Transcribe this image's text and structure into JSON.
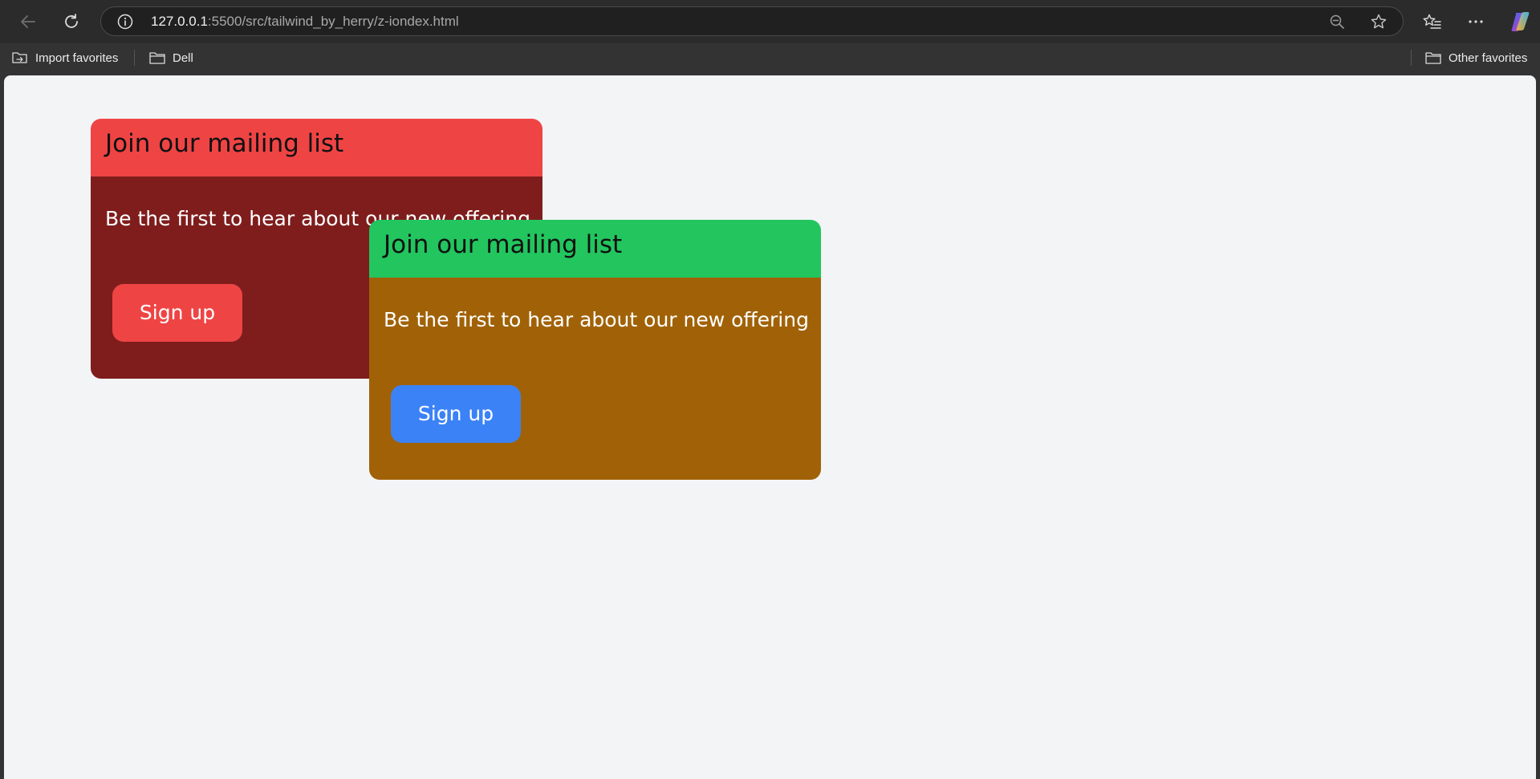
{
  "browser": {
    "url_host": "127.0.0.1",
    "url_path": ":5500/src/tailwind_by_herry/z-iondex.html"
  },
  "favorites_bar": {
    "items": [
      {
        "label": "Import favorites",
        "icon": "import-favorites-icon"
      },
      {
        "label": "Dell",
        "icon": "folder-icon"
      }
    ],
    "other_favorites": {
      "label": "Other favorites",
      "icon": "folder-icon"
    }
  },
  "page": {
    "background": "#f3f4f6",
    "cards": [
      {
        "title": "Join our mailing list",
        "text": "Be the first to hear about our new offering",
        "button_label": "Sign up",
        "header_color": "#ef4444",
        "body_color": "#7f1d1d",
        "button_color": "#ef4444"
      },
      {
        "title": "Join our mailing list",
        "text": "Be the first to hear about our new offering",
        "button_label": "Sign up",
        "header_color": "#22c55e",
        "body_color": "#a16207",
        "button_color": "#3b82f6"
      }
    ]
  }
}
